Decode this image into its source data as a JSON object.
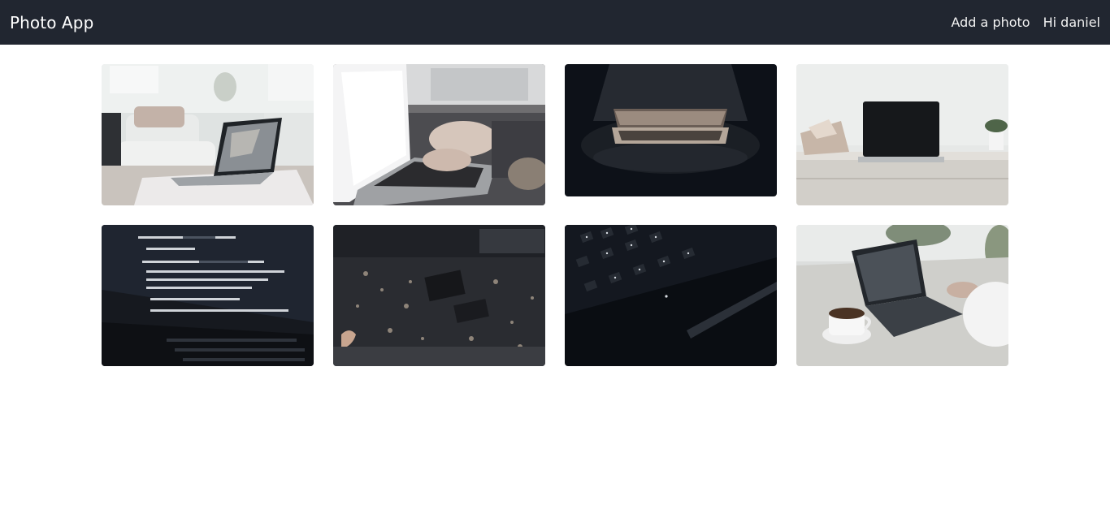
{
  "navbar": {
    "brand": "Photo App",
    "links": {
      "add_photo": "Add a photo",
      "greeting": "Hi daniel"
    }
  },
  "colors": {
    "navbar_bg": "#212630",
    "page_bg": "#ffffff"
  },
  "gallery": {
    "photos": [
      {
        "subject": "laptop-in-living-room"
      },
      {
        "subject": "hands-typing-on-laptop"
      },
      {
        "subject": "laptop-under-dark-lamp"
      },
      {
        "subject": "macbook-on-white-desk"
      },
      {
        "subject": "code-on-laptop-screen"
      },
      {
        "subject": "circuit-board-closeup"
      },
      {
        "subject": "backlit-keyboard"
      },
      {
        "subject": "laptop-with-coffee-cup"
      }
    ]
  }
}
